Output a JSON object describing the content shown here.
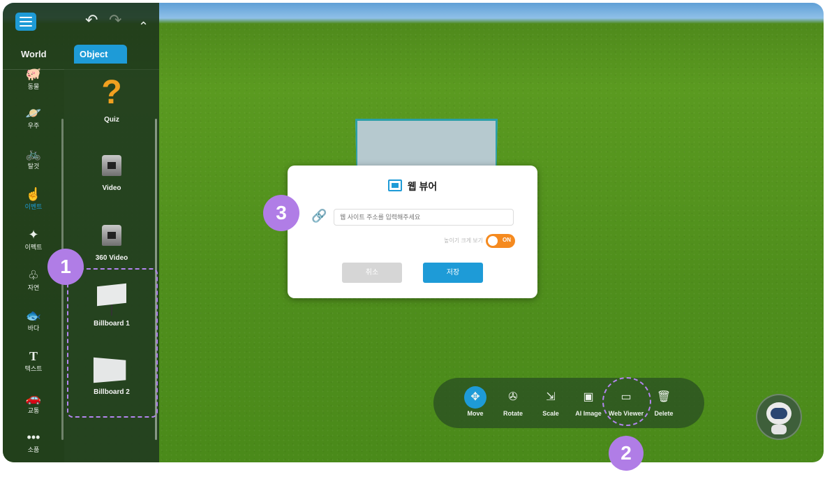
{
  "sidebar": {
    "tabs": {
      "world": "World",
      "object": "Object"
    },
    "undo_icon": "undo-icon",
    "redo_icon": "redo-icon",
    "categories": [
      {
        "label": "동물",
        "icon": "animal-icon"
      },
      {
        "label": "우주",
        "icon": "planet-icon"
      },
      {
        "label": "탈것",
        "icon": "bicycle-icon"
      },
      {
        "label": "이벤트",
        "icon": "event-icon",
        "active": true
      },
      {
        "label": "이펙트",
        "icon": "effect-icon"
      },
      {
        "label": "자연",
        "icon": "tree-icon"
      },
      {
        "label": "바다",
        "icon": "fish-icon"
      },
      {
        "label": "텍스트",
        "icon": "text-icon"
      },
      {
        "label": "교통",
        "icon": "car-icon"
      },
      {
        "label": "소품",
        "icon": "more-icon"
      }
    ],
    "objects": [
      {
        "label": "Quiz"
      },
      {
        "label": "Video"
      },
      {
        "label": "360 Video"
      },
      {
        "label": "Billboard 1"
      },
      {
        "label": "Billboard 2"
      }
    ]
  },
  "dialog": {
    "title": "웹 뷰어",
    "url_placeholder": "웹 사이트 주소를 입력해주세요",
    "toggle_label": "높이기 크게 보기",
    "toggle_state": "ON",
    "cancel": "취소",
    "save": "저장"
  },
  "toolbar": {
    "tools": [
      {
        "label": "Move",
        "icon": "move-icon",
        "active": true
      },
      {
        "label": "Rotate",
        "icon": "rotate-icon"
      },
      {
        "label": "Scale",
        "icon": "scale-icon"
      },
      {
        "label": "AI Image",
        "icon": "ai-image-icon"
      },
      {
        "label": "Web Viewer",
        "icon": "web-viewer-icon"
      },
      {
        "label": "Delete",
        "icon": "trash-icon"
      }
    ]
  },
  "annotations": {
    "step1": "1",
    "step2": "2",
    "step3": "3"
  },
  "colors": {
    "accent": "#1e9bd7",
    "annotation": "#b07de6",
    "toggle_on": "#f58a1f"
  }
}
